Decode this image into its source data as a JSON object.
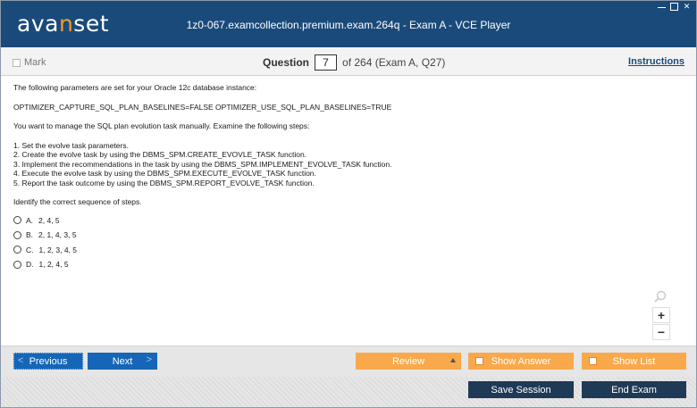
{
  "app": {
    "logo_prefix": "ava",
    "logo_accent": "n",
    "logo_suffix": "set",
    "window_title": "1z0-067.examcollection.premium.exam.264q - Exam A - VCE Player",
    "brand_color": "#1a4a7a",
    "accent_color": "#f59a23"
  },
  "toolbar": {
    "mark_label": "Mark",
    "question_label": "Question",
    "question_number": "7",
    "question_of": "of 264 (Exam A, Q27)",
    "instructions_label": "Instructions"
  },
  "question": {
    "intro": "The following parameters are set for your Oracle 12c database instance:",
    "params": "OPTIMIZER_CAPTURE_SQL_PLAN_BASELINES=FALSE OPTIMIZER_USE_SQL_PLAN_BASELINES=TRUE",
    "task": "You want to manage the SQL plan evolution task manually. Examine the following steps:",
    "steps": [
      "1. Set the evolve task parameters.",
      "2. Create the evolve task by using the DBMS_SPM.CREATE_EVOVLE_TASK function.",
      "3. Implement the recommendations in the task by using the DBMS_SPM.IMPLEMENT_EVOLVE_TASK function.",
      "4. Execute the evolve task by using the DBMS_SPM.EXECUTE_EVOLVE_TASK function.",
      "5. Report the task outcome by using the DBMS_SPM.REPORT_EVOLVE_TASK function."
    ],
    "prompt": "Identify the correct sequence of steps.",
    "options": [
      {
        "letter": "A.",
        "text": "2, 4, 5"
      },
      {
        "letter": "B.",
        "text": "2, 1, 4, 3, 5"
      },
      {
        "letter": "C.",
        "text": "1, 2, 3, 4, 5"
      },
      {
        "letter": "D.",
        "text": "1, 2, 4, 5"
      }
    ]
  },
  "zoom": {
    "icon": "magnifier-icon",
    "zoom_in_label": "+",
    "zoom_out_label": "−"
  },
  "bottom": {
    "previous_label": "Previous",
    "next_label": "Next",
    "review_label": "Review",
    "show_answer_label": "Show Answer",
    "show_list_label": "Show List",
    "save_session_label": "Save Session",
    "end_exam_label": "End Exam",
    "nav_color": "#1666b8",
    "orange_color": "#f9a94b",
    "dark_color": "#1f3a56"
  }
}
